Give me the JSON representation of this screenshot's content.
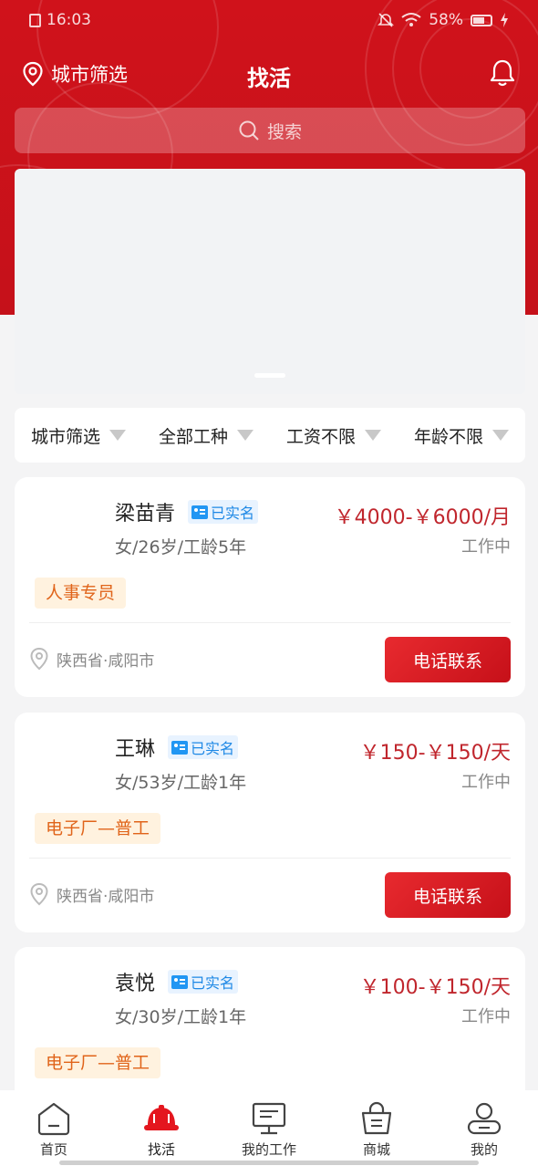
{
  "status_bar": {
    "time": "16:03",
    "battery": "58%"
  },
  "header": {
    "city_filter_label": "城市筛选",
    "title": "找活"
  },
  "search": {
    "placeholder": "搜索"
  },
  "filters": [
    "城市筛选",
    "全部工种",
    "工资不限",
    "年龄不限"
  ],
  "workers": [
    {
      "name": "梁苗青",
      "verified_label": "已实名",
      "info": "女/26岁/工龄5年",
      "salary": "￥4000-￥6000/月",
      "status": "工作中",
      "tag": "人事专员",
      "location": "陕西省·咸阳市",
      "call_label": "电话联系"
    },
    {
      "name": "王琳",
      "verified_label": "已实名",
      "info": "女/53岁/工龄1年",
      "salary": "￥150-￥150/天",
      "status": "工作中",
      "tag": "电子厂—普工",
      "location": "陕西省·咸阳市",
      "call_label": "电话联系"
    },
    {
      "name": "袁悦",
      "verified_label": "已实名",
      "info": "女/30岁/工龄1年",
      "salary": "￥100-￥150/天",
      "status": "工作中",
      "tag": "电子厂—普工",
      "location": "",
      "call_label": ""
    }
  ],
  "tabs": [
    {
      "label": "首页",
      "icon": "home-icon"
    },
    {
      "label": "找活",
      "icon": "helmet-icon",
      "active": true
    },
    {
      "label": "我的工作",
      "icon": "monitor-icon"
    },
    {
      "label": "商城",
      "icon": "shopping-bag-icon"
    },
    {
      "label": "我的",
      "icon": "user-icon"
    }
  ],
  "colors": {
    "brand_red": "#d0121b",
    "salary_red": "#c0262d",
    "tag_orange": "#e0641a",
    "verified_blue": "#1e88e5"
  }
}
